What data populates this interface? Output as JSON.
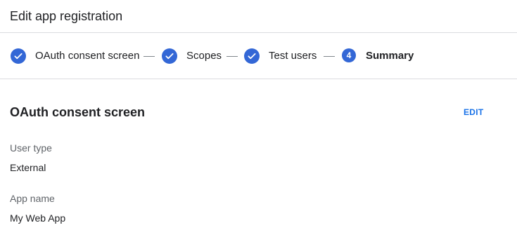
{
  "header": {
    "title": "Edit app registration"
  },
  "stepper": {
    "steps": [
      {
        "label": "OAuth consent screen",
        "state": "done"
      },
      {
        "label": "Scopes",
        "state": "done"
      },
      {
        "label": "Test users",
        "state": "done"
      },
      {
        "label": "Summary",
        "state": "current",
        "number": "4"
      }
    ]
  },
  "summary": {
    "section_title": "OAuth consent screen",
    "edit_label": "EDIT",
    "fields": [
      {
        "label": "User type",
        "value": "External"
      },
      {
        "label": "App name",
        "value": "My Web App"
      }
    ]
  },
  "colors": {
    "accent": "#3367d6",
    "link": "#1a73e8",
    "divider": "#dadce0"
  }
}
